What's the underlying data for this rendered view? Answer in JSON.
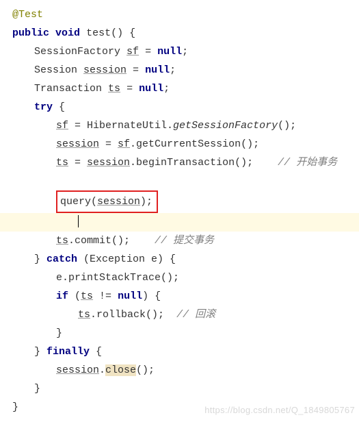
{
  "annotation": "@Test",
  "sig": {
    "public": "public",
    "void": "void",
    "name": "test",
    "parens": "()",
    "brace": "{"
  },
  "decl": {
    "sf": {
      "type": "SessionFactory",
      "name": "sf",
      "eq": " = ",
      "null": "null",
      "semi": ";"
    },
    "session": {
      "type": "Session",
      "name": "session",
      "eq": " = ",
      "null": "null",
      "semi": ";"
    },
    "ts": {
      "type": "Transaction",
      "name": "ts",
      "eq": " = ",
      "null": "null",
      "semi": ";"
    }
  },
  "try": "try",
  "body": {
    "sfAssign": {
      "lhs": "sf",
      "eq": " = HibernateUtil.",
      "call": "getSessionFactory",
      "tail": "();"
    },
    "sesAssign": {
      "lhs": "session",
      "eq": " = ",
      "obj": "sf",
      "tail": ".getCurrentSession();"
    },
    "tsAssign": {
      "lhs": "ts",
      "eq": " = ",
      "obj": "session",
      "tail": ".beginTransaction();",
      "gap": "    ",
      "comment": "// 开始事务"
    },
    "queryCall": {
      "fn": "query",
      "open": "(",
      "arg": "session",
      "close": ");"
    },
    "commit": {
      "obj": "ts",
      "tail": ".commit();",
      "gap": "    ",
      "comment": "// 提交事务"
    }
  },
  "catch": {
    "close": "} ",
    "kw": "catch",
    "params": " (Exception e) {"
  },
  "catchBody": {
    "print": "e.printStackTrace();",
    "if": {
      "kw": "if",
      "open": " (",
      "var": "ts",
      "rest": " != ",
      "null": "null",
      "close": ") {"
    },
    "rollback": {
      "obj": "ts",
      "tail": ".rollback();",
      "gap": "  ",
      "comment": "// 回滚"
    },
    "closeIf": "}"
  },
  "finally": {
    "close": "} ",
    "kw": "finally",
    "open": " {"
  },
  "finallyBody": {
    "obj": "session",
    "dot": ".",
    "call": "close",
    "tail": "();"
  },
  "closeFinally": "}",
  "closeMethod": "}",
  "watermark": "https://blog.csdn.net/Q_1849805767"
}
